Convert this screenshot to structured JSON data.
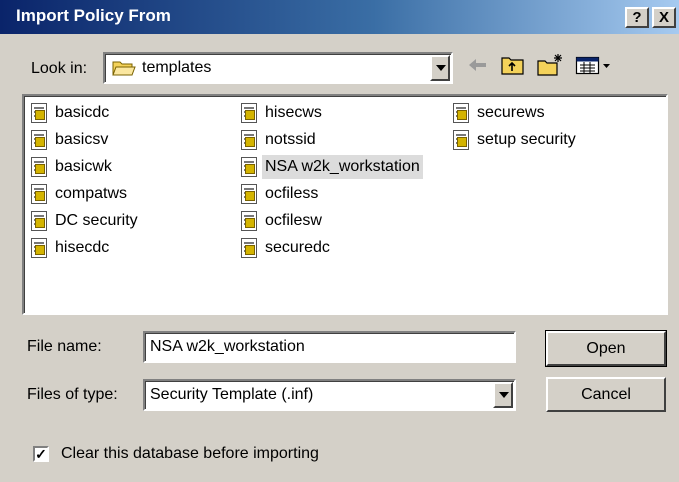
{
  "window": {
    "title": "Import Policy From",
    "help_glyph": "?",
    "close_glyph": "X"
  },
  "look_in": {
    "label": "Look in:",
    "value": "templates"
  },
  "toolbar": {
    "icons": [
      "back-arrow-icon",
      "up-folder-icon",
      "new-folder-icon",
      "view-menu-icon"
    ]
  },
  "files": {
    "column1": [
      "basicdc",
      "basicsv",
      "basicwk",
      "compatws",
      "DC security",
      "hisecdc"
    ],
    "column2": [
      "hisecws",
      "notssid",
      "NSA w2k_workstation",
      "ocfiless",
      "ocfilesw",
      "securedc"
    ],
    "column3": [
      "securews",
      "setup security"
    ],
    "selected": "NSA w2k_workstation"
  },
  "file_name": {
    "label": "File name:",
    "value": "NSA w2k_workstation"
  },
  "file_type": {
    "label": "Files of type:",
    "value": "Security Template (.inf)"
  },
  "buttons": {
    "open": "Open",
    "cancel": "Cancel"
  },
  "option": {
    "checked": true,
    "check_glyph": "✓",
    "label": "Clear this database before importing"
  },
  "colors": {
    "title_gradient_start": "#0a246a",
    "title_gradient_end": "#a6caf0",
    "face": "#d4d0c8"
  }
}
